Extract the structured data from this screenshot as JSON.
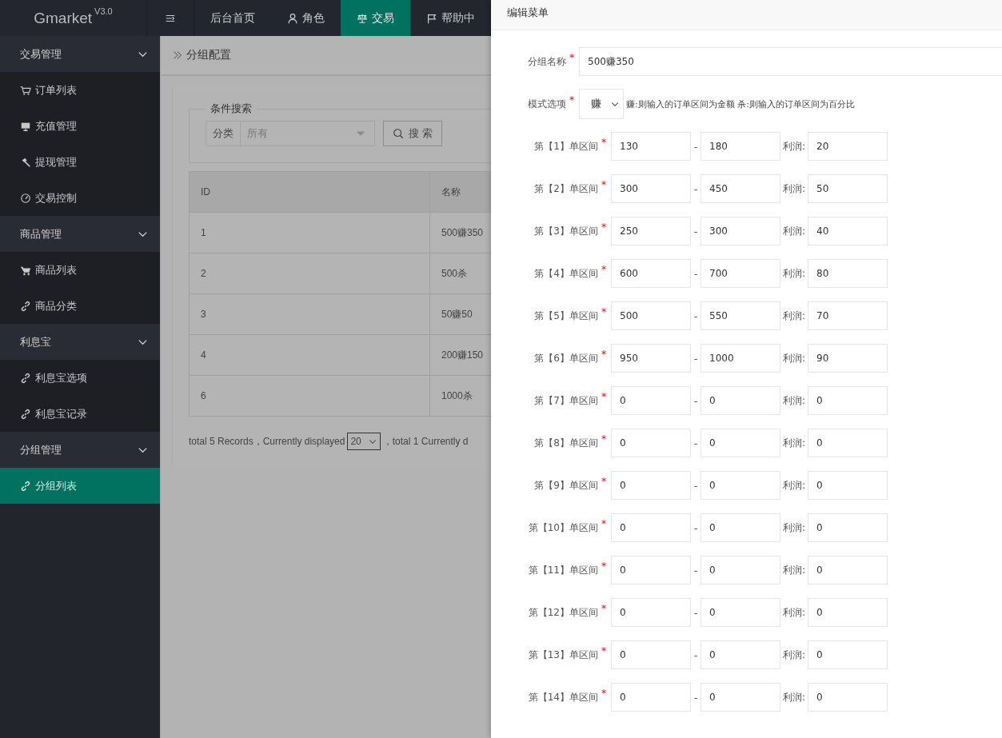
{
  "brand": {
    "name": "Gmarket",
    "version": "V3.0"
  },
  "top_nav": [
    {
      "label": "后台首页",
      "selected": false
    },
    {
      "label": "角色",
      "selected": false
    },
    {
      "label": "交易",
      "selected": true
    },
    {
      "label": "帮助中",
      "selected": false
    }
  ],
  "sidebar": [
    {
      "label": "交易管理",
      "expanded": true,
      "children": [
        {
          "label": "订单列表",
          "selected": false
        },
        {
          "label": "充值管理",
          "selected": false
        },
        {
          "label": "提现管理",
          "selected": false
        },
        {
          "label": "交易控制",
          "selected": false
        }
      ]
    },
    {
      "label": "商品管理",
      "expanded": true,
      "children": [
        {
          "label": "商品列表",
          "selected": false
        },
        {
          "label": "商品分类",
          "selected": false
        }
      ]
    },
    {
      "label": "利息宝",
      "expanded": true,
      "children": [
        {
          "label": "利息宝选项",
          "selected": false
        },
        {
          "label": "利息宝记录",
          "selected": false
        }
      ]
    },
    {
      "label": "分组管理",
      "expanded": true,
      "children": [
        {
          "label": "分组列表",
          "selected": true
        }
      ]
    }
  ],
  "breadcrumb": "分组配置",
  "search": {
    "legend": "条件搜索",
    "label": "分类",
    "value": "所有",
    "button": "搜 索"
  },
  "table": {
    "columns": [
      "ID",
      "名称"
    ],
    "rows": [
      [
        "1",
        "500赚350"
      ],
      [
        "2",
        "500杀"
      ],
      [
        "3",
        "50赚50"
      ],
      [
        "4",
        "200赚150"
      ],
      [
        "6",
        "1000杀"
      ]
    ]
  },
  "pager": {
    "before": "total 5 Records，Currently displayed",
    "page_size": "20",
    "after": "，total 1 Currently d"
  },
  "panel": {
    "title": "编辑菜单",
    "name_field": {
      "label": "分组名称",
      "required": "*",
      "value": "500赚350"
    },
    "mode_field": {
      "label": "模式选项",
      "required": "*",
      "value": "赚",
      "hint": "赚:则输入的订单区间为金额 杀:则输入的订单区间为百分比"
    },
    "ranges": [
      {
        "label": "第【1】单区间",
        "required": "*",
        "from": "130",
        "dash": "-",
        "to": "180",
        "profit_label": "利润:",
        "profit": "20"
      },
      {
        "label": "第【2】单区间",
        "required": "*",
        "from": "300",
        "dash": "-",
        "to": "450",
        "profit_label": "利润:",
        "profit": "50"
      },
      {
        "label": "第【3】单区间",
        "required": "*",
        "from": "250",
        "dash": "-",
        "to": "300",
        "profit_label": "利润:",
        "profit": "40"
      },
      {
        "label": "第【4】单区间",
        "required": "*",
        "from": "600",
        "dash": "-",
        "to": "700",
        "profit_label": "利润:",
        "profit": "80"
      },
      {
        "label": "第【5】单区间",
        "required": "*",
        "from": "500",
        "dash": "-",
        "to": "550",
        "profit_label": "利润:",
        "profit": "70"
      },
      {
        "label": "第【6】单区间",
        "required": "*",
        "from": "950",
        "dash": "-",
        "to": "1000",
        "profit_label": "利润:",
        "profit": "90"
      },
      {
        "label": "第【7】单区间",
        "required": "*",
        "from": "0",
        "dash": "-",
        "to": "0",
        "profit_label": "利润:",
        "profit": "0"
      },
      {
        "label": "第【8】单区间",
        "required": "*",
        "from": "0",
        "dash": "-",
        "to": "0",
        "profit_label": "利润:",
        "profit": "0"
      },
      {
        "label": "第【9】单区间",
        "required": "*",
        "from": "0",
        "dash": "-",
        "to": "0",
        "profit_label": "利润:",
        "profit": "0"
      },
      {
        "label": "第【10】单区间",
        "required": "*",
        "from": "0",
        "dash": "-",
        "to": "0",
        "profit_label": "利润:",
        "profit": "0"
      },
      {
        "label": "第【11】单区间",
        "required": "*",
        "from": "0",
        "dash": "-",
        "to": "0",
        "profit_label": "利润:",
        "profit": "0"
      },
      {
        "label": "第【12】单区间",
        "required": "*",
        "from": "0",
        "dash": "-",
        "to": "0",
        "profit_label": "利润:",
        "profit": "0"
      },
      {
        "label": "第【13】单区间",
        "required": "*",
        "from": "0",
        "dash": "-",
        "to": "0",
        "profit_label": "利润:",
        "profit": "0"
      },
      {
        "label": "第【14】单区间",
        "required": "*",
        "from": "0",
        "dash": "-",
        "to": "0",
        "profit_label": "利润:",
        "profit": "0"
      }
    ]
  }
}
